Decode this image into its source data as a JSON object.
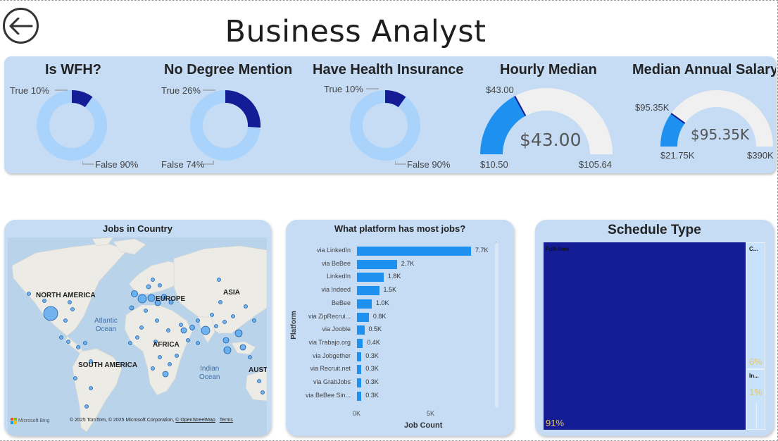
{
  "page": {
    "title": "Business Analyst"
  },
  "colors": {
    "dark": "#141c96",
    "light": "#a9d3fb",
    "gaugeFill": "#1e90f0",
    "gaugeTrack": "#f0f0f0",
    "accentText": "#e8c65a"
  },
  "kpis": {
    "wfh": {
      "title": "Is WFH?",
      "true_label": "True 10%",
      "false_label": "False 90%",
      "true_pct": 10
    },
    "degree": {
      "title": "No Degree Mention",
      "true_label": "True 26%",
      "false_label": "False 74%",
      "true_pct": 26
    },
    "health": {
      "title": "Have Health Insurance",
      "true_label": "True 10%",
      "false_label": "False 90%",
      "true_pct": 10
    },
    "hourly": {
      "title": "Hourly Median",
      "value_label": "$43.00",
      "target_label": "$43.00",
      "min_label": "$10.50",
      "max_label": "$105.64",
      "value": 43.0,
      "min": 10.5,
      "max": 105.64
    },
    "annual": {
      "title": "Median Annual Salary",
      "value_label": "$95.35K",
      "target_label": "$95.35K",
      "min_label": "$21.75K",
      "max_label": "$390K",
      "value": 95.35,
      "min": 21.75,
      "max": 390
    }
  },
  "map_card": {
    "title": "Jobs in Country",
    "labels": {
      "north_america": "NORTH AMERICA",
      "south_america": "SOUTH AMERICA",
      "europe": "EUROPE",
      "asia": "ASIA",
      "africa": "AFRICA",
      "australia": "AUST"
    },
    "oceans": {
      "atlantic": "Atlantic\nOcean",
      "indian": "Indian\nOcean"
    },
    "logo": "Microsoft Bing",
    "copyright": "© 2025 TomTom, © 2025 Microsoft Corporation,",
    "osm_link": "© OpenStreetMap",
    "terms_link": "Terms"
  },
  "platform_card": {
    "title": "What platform has most jobs?"
  },
  "schedule_card": {
    "title": "Schedule Type",
    "main_label": "Full-time",
    "main_pct": "91%",
    "side1_label": "C...",
    "side1_pct": "6%",
    "side2_label": "In...",
    "side2_pct": "1%"
  },
  "chart_data": {
    "type": "bar",
    "orientation": "horizontal",
    "title": "What platform has most jobs?",
    "xlabel": "Job Count",
    "ylabel": "Platform",
    "categories": [
      "via LinkedIn",
      "via BeBee",
      "LinkedIn",
      "via Indeed",
      "BeBee",
      "via ZipRecrui...",
      "via Jooble",
      "via Trabajo.org",
      "via Jobgether",
      "via Recruit.net",
      "via GrabJobs",
      "via BeBee Sin..."
    ],
    "values": [
      7700,
      2700,
      1800,
      1500,
      1000,
      800,
      500,
      400,
      300,
      300,
      300,
      300
    ],
    "value_labels": [
      "7.7K",
      "2.7K",
      "1.8K",
      "1.5K",
      "1.0K",
      "0.8K",
      "0.5K",
      "0.4K",
      "0.3K",
      "0.3K",
      "0.3K",
      "0.3K"
    ],
    "xticks": [
      "0K",
      "5K"
    ],
    "xlim": [
      0,
      8000
    ]
  }
}
